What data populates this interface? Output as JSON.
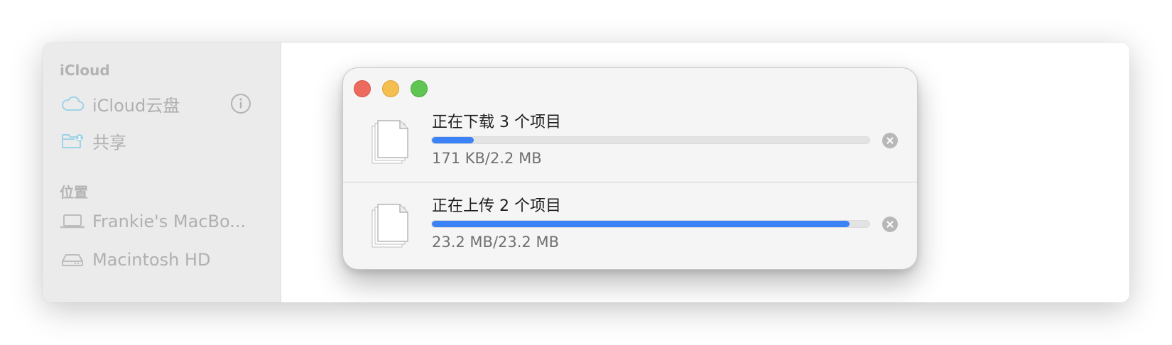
{
  "sidebar": {
    "icloud_section": "iCloud",
    "items_icloud": [
      {
        "label": "iCloud云盘",
        "icon": "cloud-icon"
      },
      {
        "label": "共享",
        "icon": "shared-folder-icon"
      }
    ],
    "locations_section": "位置",
    "items_locations": [
      {
        "label": "Frankie's MacBo...",
        "icon": "laptop-icon"
      },
      {
        "label": "Macintosh HD",
        "icon": "hard-drive-icon"
      }
    ]
  },
  "progress_window": {
    "transfers": [
      {
        "title": "正在下载 3 个项目",
        "size": "171 KB/2.2 MB",
        "progress": 0.095
      },
      {
        "title": "正在上传 2 个项目",
        "size": "23.2 MB/23.2 MB",
        "progress": 0.955
      }
    ]
  },
  "colors": {
    "accent": "#3b82f6",
    "close": "#ed6a5e",
    "minimize": "#f5bf4f",
    "maximize": "#61c554"
  }
}
